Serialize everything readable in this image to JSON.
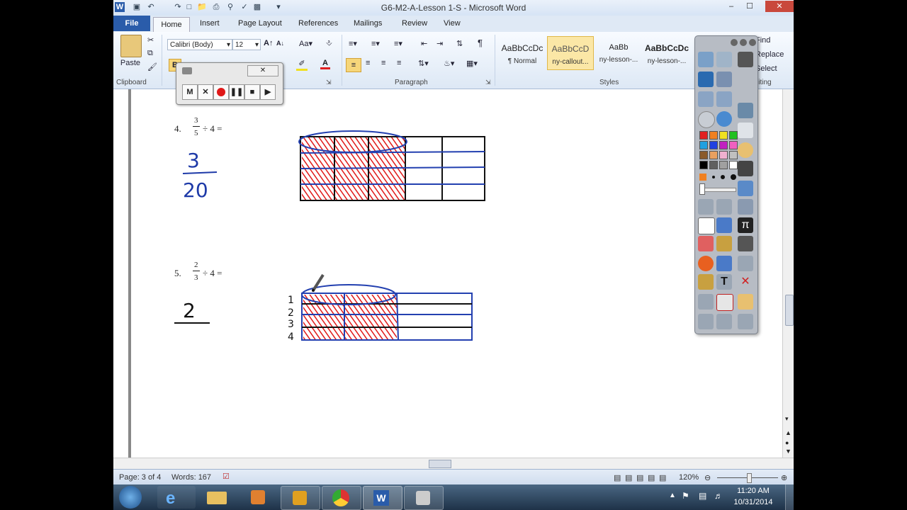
{
  "window": {
    "title": "G6-M2-A-Lesson 1-S  -  Microsoft Word",
    "minimize": "–",
    "maximize": "☐",
    "close": "✕"
  },
  "ribbon_tabs": [
    "File",
    "Home",
    "Insert",
    "Page Layout",
    "References",
    "Mailings",
    "Review",
    "View"
  ],
  "clipboard": {
    "paste_label": "Paste",
    "group_label": "Clipboard"
  },
  "font": {
    "name": "Calibri (Body)",
    "size": "12",
    "bold": "B"
  },
  "paragraph": {
    "group_label": "Paragraph",
    "pilcrow": "¶"
  },
  "styles": {
    "group_label": "Styles",
    "items": [
      {
        "sample": "AaBbCcDc",
        "name": "¶ Normal"
      },
      {
        "sample": "AaBbCcD",
        "name": "ny-callout..."
      },
      {
        "sample": "AaBb",
        "name": "ny-lesson-..."
      },
      {
        "sample": "AaBbCcDc",
        "name": "ny-lesson-..."
      }
    ]
  },
  "editing": {
    "find": "Find",
    "replace": "Replace",
    "select": "Select",
    "group_label": "Editing"
  },
  "recorder": {
    "m": "M",
    "x": "✕",
    "close": "✕"
  },
  "problems": [
    {
      "number": "4.",
      "numerator": "3",
      "denominator": "5",
      "rest": "÷ 4 ="
    },
    {
      "number": "5.",
      "numerator": "2",
      "denominator": "3",
      "rest": "÷ 4 ="
    }
  ],
  "handwriting": {
    "answer4_num": "3",
    "answer4_den": "20",
    "answer5_num": "2",
    "row_labels": [
      "1",
      "2",
      "3",
      "4"
    ],
    "ink_colors": {
      "blue": "#1e3aa8",
      "red": "#e01818",
      "black": "#111111"
    }
  },
  "status": {
    "page": "Page: 3 of 4",
    "words": "Words: 167",
    "zoom": "120%"
  },
  "taskbar": {
    "time": "11:20 AM",
    "date": "10/31/2014"
  },
  "toolbar_colors": [
    "#e02020",
    "#f08020",
    "#f0e020",
    "#20c020",
    "#20a0e0",
    "#2040e0",
    "#c020c0",
    "#f060c0",
    "#8a5a2a",
    "#e8a060",
    "#f0b0d0",
    "#c0c0c0",
    "#000000",
    "#606060",
    "#a0a0a0",
    "#ffffff"
  ]
}
